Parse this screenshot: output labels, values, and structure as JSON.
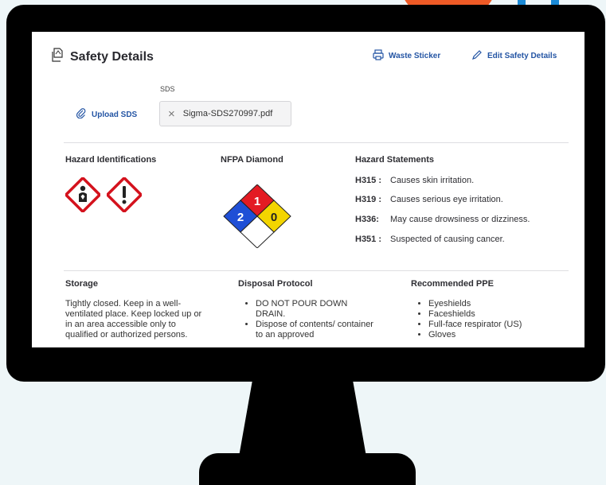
{
  "header": {
    "title": "Safety Details",
    "waste_sticker": "Waste Sticker",
    "edit_safety_details": "Edit Safety Details"
  },
  "sds": {
    "label": "SDS",
    "upload_label": "Upload SDS",
    "file_name": "Sigma-SDS270997.pdf"
  },
  "hazard_identifications": {
    "heading": "Hazard Identifications",
    "pictograms": [
      "health-hazard-icon",
      "exclamation-mark-icon"
    ]
  },
  "nfpa": {
    "heading": "NFPA Diamond",
    "health": "2",
    "flammability": "1",
    "instability": "0",
    "special": "",
    "colors": {
      "health": "#1f4fd6",
      "flammability": "#e31b23",
      "instability": "#f3d500",
      "special": "#ffffff"
    }
  },
  "hazard_statements": {
    "heading": "Hazard Statements",
    "items": [
      {
        "code": "H315 :",
        "text": "Causes skin irritation."
      },
      {
        "code": "H319 :",
        "text": "Causes serious eye irritation."
      },
      {
        "code": "H336:",
        "text": "May cause drowsiness or dizziness."
      },
      {
        "code": "H351 :",
        "text": "Suspected of causing cancer."
      }
    ]
  },
  "storage": {
    "heading": "Storage",
    "text": "Tightly closed. Keep in a well-ventilated place. Keep locked up or in an area accessible only to qualified or authorized persons."
  },
  "disposal": {
    "heading": "Disposal Protocol",
    "items": [
      "DO NOT POUR DOWN DRAIN.",
      "Dispose of contents/ container to an approved"
    ]
  },
  "ppe": {
    "heading": "Recommended PPE",
    "items": [
      "Eyeshields",
      "Faceshields",
      "Full-face respirator (US)",
      "Gloves"
    ]
  },
  "colors": {
    "link": "#2455a4",
    "pictogram_red": "#d4121d"
  }
}
